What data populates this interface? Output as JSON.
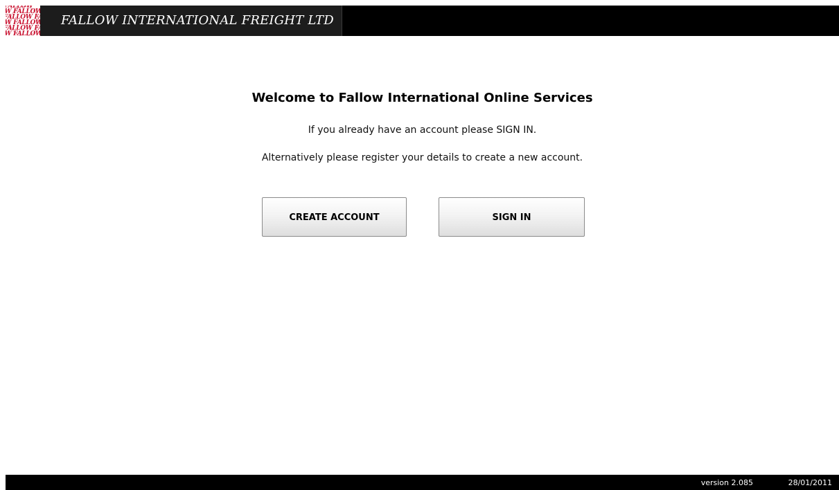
{
  "header": {
    "logo_text": "FALLOW FALLOW FALLOW",
    "brand_title": "FALLOW INTERNATIONAL FREIGHT LTD"
  },
  "main": {
    "welcome_title": "Welcome to Fallow International Online Services",
    "intro_signin": "If you already have an account please SIGN IN.",
    "intro_register": "Alternatively please register your details to create a new account.",
    "create_account_label": "CREATE ACCOUNT",
    "sign_in_label": "SIGN IN"
  },
  "footer": {
    "version": "version 2.085",
    "date": "28/01/2011"
  },
  "colors": {
    "header_bg": "#000000",
    "logo_red": "#c8102e",
    "button_border": "#8a8a8a"
  }
}
